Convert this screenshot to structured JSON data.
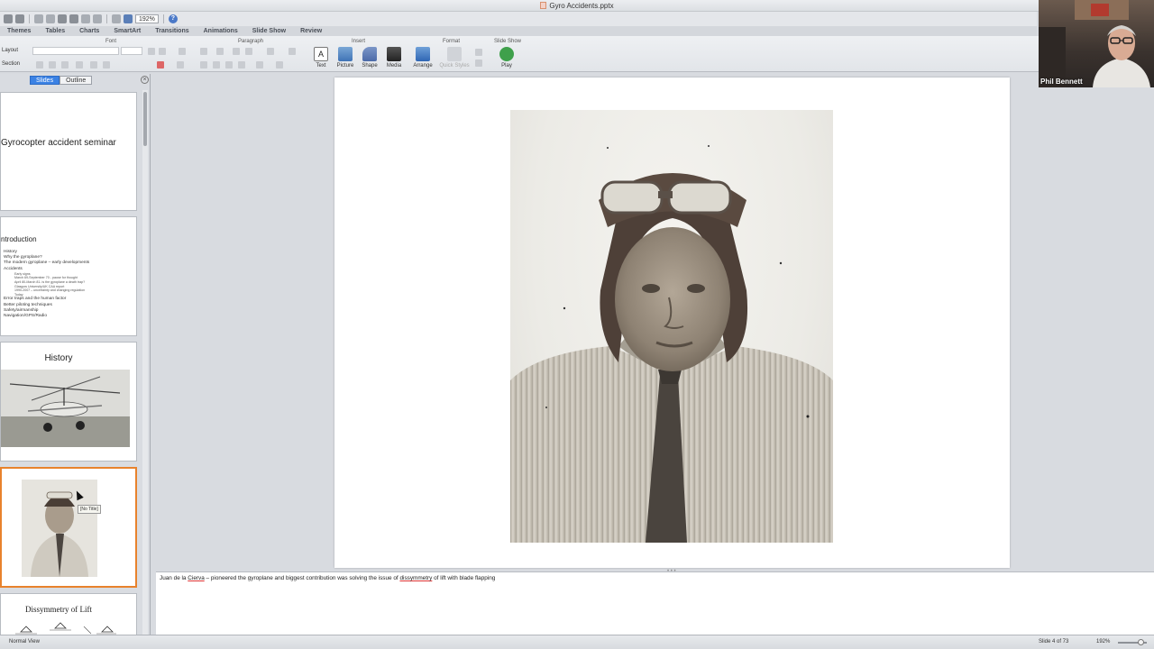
{
  "window": {
    "title": "Gyro Accidents.pptx"
  },
  "quick_toolbar": {
    "zoom": "192%"
  },
  "ribbon_tabs": [
    "Themes",
    "Tables",
    "Charts",
    "SmartArt",
    "Transitions",
    "Animations",
    "Slide Show",
    "Review"
  ],
  "ribbon": {
    "groups": {
      "font": "Font",
      "paragraph": "Paragraph",
      "insert": "Insert",
      "format": "Format",
      "slide_show": "Slide Show"
    },
    "slides_group": {
      "layout": "Layout",
      "section": "Section"
    },
    "insert_buttons": {
      "text": "Text",
      "picture": "Picture",
      "shape": "Shape",
      "media": "Media"
    },
    "format_buttons": {
      "arrange": "Arrange",
      "quick_styles": "Quick Styles"
    },
    "slideshow_buttons": {
      "play": "Play"
    }
  },
  "sidebar": {
    "tabs": {
      "slides": "Slides",
      "outline": "Outline"
    },
    "slides": [
      {
        "title": "Gyrocopter accident seminar"
      },
      {
        "title": "ntroduction",
        "bullets": [
          "History",
          "Why the gyroplane?",
          "The modern gyroplane – early developments",
          "Accidents"
        ],
        "sub_bullets": [
          "Early signs",
          "March 69-September 70 - pause for thought",
          "April 80-March 81- is the gyroplane a death trap?",
          "Glasgow University/UK CAA report",
          "1990-2007 – uncertainty and changing regulation",
          "Today"
        ],
        "bullets_after": [
          "Error traps and the human factor",
          "Better piloting techniques",
          "Safety/airmanship",
          "Navigation/GPS/Radio"
        ]
      },
      {
        "title": "History"
      },
      {
        "tooltip": "[No Title]"
      },
      {
        "title": "Dissymmetry of Lift"
      }
    ]
  },
  "notes": {
    "before_name": "Juan de la ",
    "name_underlined": "Cierva",
    "middle": " – pioneered the gyroplane and biggest contribution was solving the issue of ",
    "word_underlined": "dissymmetry",
    "after": " of lift with blade flapping"
  },
  "status_bar": {
    "view": "Normal View",
    "slide_position": "Slide 4 of 73",
    "zoom": "192%"
  },
  "webcam": {
    "name": "Phil Bennett"
  }
}
